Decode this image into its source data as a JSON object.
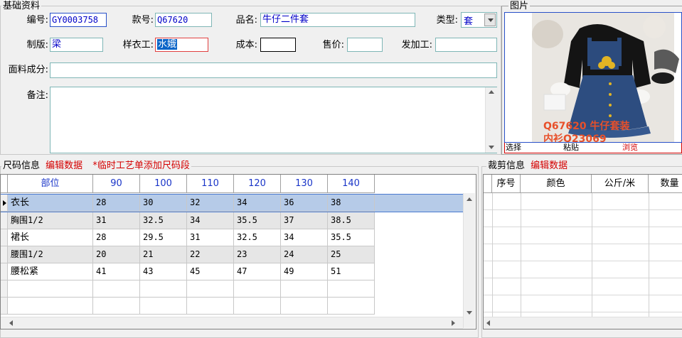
{
  "basic": {
    "legend": "基础资料",
    "labels": {
      "code": "编号:",
      "style_no": "款号:",
      "product_name": "品名:",
      "type": "类型:",
      "pattern_maker": "制版:",
      "sample_worker": "样衣工:",
      "cost": "成本:",
      "price": "售价:",
      "outsource": "发加工:",
      "fabric": "面料成分:",
      "remark": "备注:"
    },
    "values": {
      "code": "GY0003758",
      "style_no": "Q67620",
      "product_name": "牛仔二件套",
      "type": "套",
      "pattern_maker": "梁",
      "sample_worker": "水娥",
      "cost": "",
      "price": "",
      "outsource": "",
      "fabric": "",
      "remark": ""
    }
  },
  "picture": {
    "legend": "图片",
    "caption_line1": "Q67620 牛仔套装",
    "caption_line2": "内衫Q23069",
    "buttons": {
      "select": "选择",
      "paste": "粘贴",
      "browse": "浏览"
    }
  },
  "size_info": {
    "legend": "尺码信息",
    "edit_link": "编辑数据",
    "notice": "*临时工艺单添加尺码段",
    "headers": [
      "部位",
      "90",
      "100",
      "110",
      "120",
      "130",
      "140"
    ],
    "rows": [
      [
        "衣长",
        "28",
        "30",
        "32",
        "34",
        "36",
        "38"
      ],
      [
        "胸围1/2",
        "31",
        "32.5",
        "34",
        "35.5",
        "37",
        "38.5"
      ],
      [
        "裙长",
        "28",
        "29.5",
        "31",
        "32.5",
        "34",
        "35.5"
      ],
      [
        "腰围1/2",
        "20",
        "21",
        "22",
        "23",
        "24",
        "25"
      ],
      [
        "腰松紧",
        "41",
        "43",
        "45",
        "47",
        "49",
        "51"
      ]
    ]
  },
  "cut_info": {
    "legend": "裁剪信息",
    "edit_link": "编辑数据",
    "headers": [
      "序号",
      "颜色",
      "公斤/米",
      "数量"
    ]
  },
  "colors": {
    "accent_red": "#d40000",
    "header_blue": "#1a35c8",
    "selected_row": "#b6cbe8"
  }
}
